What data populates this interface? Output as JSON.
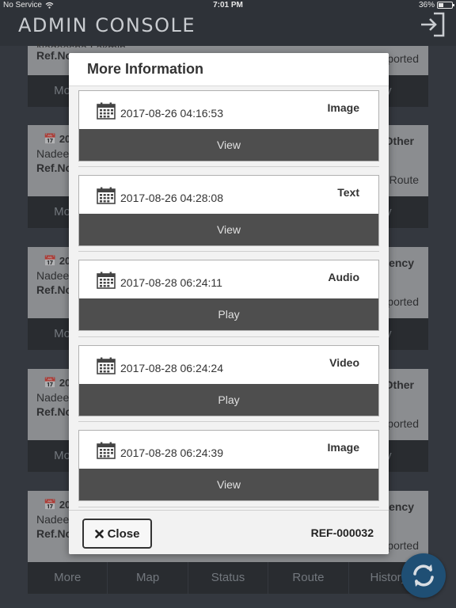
{
  "status_bar": {
    "carrier": "No Service",
    "time": "7:01 PM",
    "battery": "36%",
    "battery_level": 0.36
  },
  "header": {
    "title": "ADMIN CONSOLE",
    "logout_icon": "logout-icon"
  },
  "background": {
    "top_partial": {
      "name": "Nadeesha Lakmin",
      "ref": "Ref.No",
      "right_text": "ported",
      "more": "More",
      "right_action": "y"
    },
    "cards": [
      {
        "date_prefix": "20",
        "tag": "Other",
        "name": "Nadee",
        "ref": "Ref.No",
        "right_text": "Route",
        "left_action": "More",
        "right_action": "y"
      },
      {
        "date_prefix": "20",
        "tag": "ency",
        "name": "Nadee",
        "ref": "Ref.No",
        "right_text": "ported",
        "left_action": "More",
        "right_action": "y"
      },
      {
        "date_prefix": "20",
        "tag": "Other",
        "name": "Nadee",
        "ref": "Ref.No",
        "right_text": "ported",
        "left_action": "More",
        "right_action": "y"
      },
      {
        "date_prefix": "20",
        "tag": "ency",
        "name": "Nadee",
        "ref": "Ref.No",
        "right_text": "ported"
      }
    ],
    "bottom_actions": [
      "More",
      "Map",
      "Status",
      "Route",
      "History"
    ]
  },
  "modal": {
    "title": "More Information",
    "items": [
      {
        "datetime": "2017-08-26 04:16:53",
        "type": "Image",
        "action": "View"
      },
      {
        "datetime": "2017-08-26 04:28:08",
        "type": "Text",
        "action": "View"
      },
      {
        "datetime": "2017-08-28 06:24:11",
        "type": "Audio",
        "action": "Play"
      },
      {
        "datetime": "2017-08-28 06:24:24",
        "type": "Video",
        "action": "Play"
      },
      {
        "datetime": "2017-08-28 06:24:39",
        "type": "Image",
        "action": "View"
      }
    ],
    "close_label": "Close",
    "ref_code": "REF-000032"
  },
  "fab": {
    "icon": "refresh-icon"
  }
}
